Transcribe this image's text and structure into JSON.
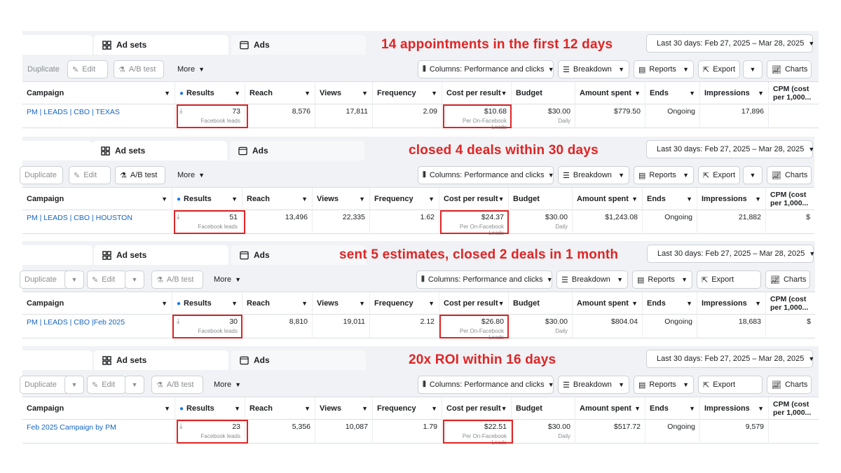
{
  "colors": {
    "highlight": "#e02424",
    "link": "#1565c0",
    "info": "#1877f2"
  },
  "panels": [
    {
      "tabs": {
        "adsets": "Ad sets",
        "ads": "Ads"
      },
      "headline": "14 appointments in the first 12 days",
      "date_range": "Last 30 days: Feb 27, 2025 – Mar 28, 2025",
      "toolbar": {
        "duplicate": "Duplicate",
        "edit": "Edit",
        "ab_test": "A/B test",
        "more": "More",
        "columns": "Columns: Performance and clicks",
        "breakdown": "Breakdown",
        "reports": "Reports",
        "export": "Export",
        "charts": "Charts"
      },
      "headers": {
        "campaign": "Campaign",
        "results": "Results",
        "reach": "Reach",
        "views": "Views",
        "frequency": "Frequency",
        "cost_per_result": "Cost per result",
        "budget": "Budget",
        "amount_spent": "Amount spent",
        "ends": "Ends",
        "impressions": "Impressions",
        "cpm": "CPM (cost per 1,000..."
      },
      "row": {
        "campaign": "PM | LEADS | CBO | TEXAS",
        "results": "73",
        "results_sub": "Facebook leads",
        "reach": "8,576",
        "views": "17,811",
        "frequency": "2.09",
        "cost": "$10.68",
        "cost_sub": "Per On-Facebook Leads",
        "budget": "$30.00",
        "budget_sub": "Daily",
        "amount_spent": "$779.50",
        "ends": "Ongoing",
        "impressions": "17,896",
        "cpm": ""
      }
    },
    {
      "tabs": {
        "adsets": "Ad sets",
        "ads": "Ads"
      },
      "headline": "closed 4 deals within 30 days",
      "date_range": "Last 30 days: Feb 27, 2025 – Mar 28, 2025",
      "toolbar": {
        "duplicate": "Duplicate",
        "edit": "Edit",
        "ab_test": "A/B test",
        "more": "More",
        "columns": "Columns: Performance and clicks",
        "breakdown": "Breakdown",
        "reports": "Reports",
        "export": "Export",
        "charts": "Charts"
      },
      "headers": {
        "campaign": "Campaign",
        "results": "Results",
        "reach": "Reach",
        "views": "Views",
        "frequency": "Frequency",
        "cost_per_result": "Cost per result",
        "budget": "Budget",
        "amount_spent": "Amount spent",
        "ends": "Ends",
        "impressions": "Impressions",
        "cpm": "CPM (cost per 1,000..."
      },
      "row": {
        "campaign": "PM | LEADS | CBO | HOUSTON",
        "results": "51",
        "results_sub": "Facebook leads",
        "reach": "13,496",
        "views": "22,335",
        "frequency": "1.62",
        "cost": "$24.37",
        "cost_sub": "Per On-Facebook Leads",
        "budget": "$30.00",
        "budget_sub": "Daily",
        "amount_spent": "$1,243.08",
        "ends": "Ongoing",
        "impressions": "21,882",
        "cpm": "$"
      }
    },
    {
      "tabs": {
        "adsets": "Ad sets",
        "ads": "Ads"
      },
      "headline": "sent 5 estimates, closed 2 deals in 1 month",
      "date_range": "Last 30 days: Feb 27, 2025 – Mar 28, 2025",
      "toolbar": {
        "duplicate": "Duplicate",
        "edit": "Edit",
        "ab_test": "A/B test",
        "more": "More",
        "columns": "Columns: Performance and clicks",
        "breakdown": "Breakdown",
        "reports": "Reports",
        "export": "Export",
        "charts": "Charts"
      },
      "headers": {
        "campaign": "Campaign",
        "results": "Results",
        "reach": "Reach",
        "views": "Views",
        "frequency": "Frequency",
        "cost_per_result": "Cost per result",
        "budget": "Budget",
        "amount_spent": "Amount spent",
        "ends": "Ends",
        "impressions": "Impressions",
        "cpm": "CPM (cost per 1,000..."
      },
      "row": {
        "campaign": "PM | LEADS | CBO |Feb 2025",
        "results": "30",
        "results_sub": "Facebook leads",
        "reach": "8,810",
        "views": "19,011",
        "frequency": "2.12",
        "cost": "$26.80",
        "cost_sub": "Per On-Facebook Leads",
        "budget": "$30.00",
        "budget_sub": "Daily",
        "amount_spent": "$804.04",
        "ends": "Ongoing",
        "impressions": "18,683",
        "cpm": "$"
      }
    },
    {
      "tabs": {
        "adsets": "Ad sets",
        "ads": "Ads"
      },
      "headline": "20x ROI within 16 days",
      "date_range": "Last 30 days: Feb 27, 2025 – Mar 28, 2025",
      "toolbar": {
        "duplicate": "Duplicate",
        "edit": "Edit",
        "ab_test": "A/B test",
        "more": "More",
        "columns": "Columns: Performance and clicks",
        "breakdown": "Breakdown",
        "reports": "Reports",
        "export": "Export",
        "charts": "Charts"
      },
      "headers": {
        "campaign": "Campaign",
        "results": "Results",
        "reach": "Reach",
        "views": "Views",
        "frequency": "Frequency",
        "cost_per_result": "Cost per result",
        "budget": "Budget",
        "amount_spent": "Amount spent",
        "ends": "Ends",
        "impressions": "Impressions",
        "cpm": "CPM (cost per 1,000..."
      },
      "row": {
        "campaign": "Feb 2025 Campaign by PM",
        "results": "23",
        "results_sub": "Facebook leads",
        "reach": "5,356",
        "views": "10,087",
        "frequency": "1.79",
        "cost": "$22.51",
        "cost_sub": "Per On-Facebook Leads",
        "budget": "$30.00",
        "budget_sub": "Daily",
        "amount_spent": "$517.72",
        "ends": "Ongoing",
        "impressions": "9,579",
        "cpm": ""
      }
    }
  ]
}
